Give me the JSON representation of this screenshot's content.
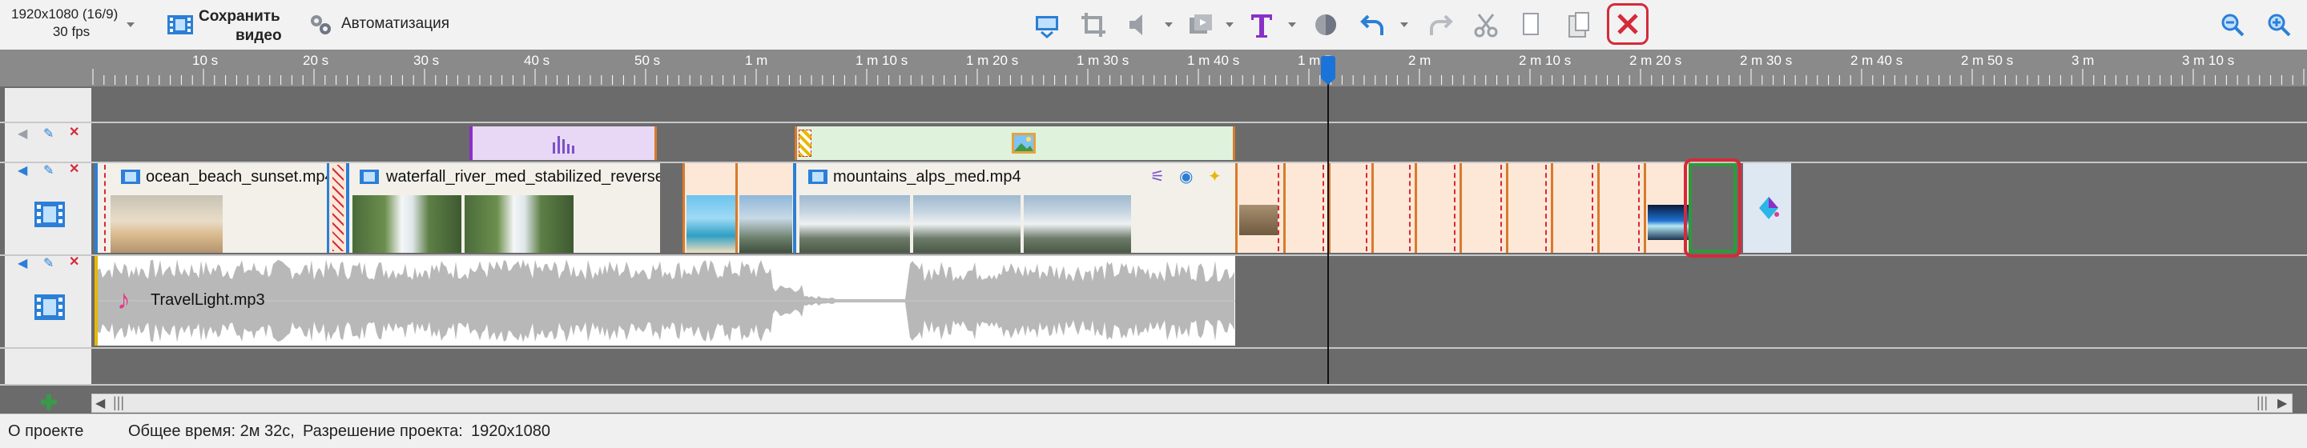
{
  "toolbar": {
    "resolution_line1": "1920x1080 (16/9)",
    "resolution_line2": "30 fps",
    "save_line1": "Сохранить",
    "save_line2": "видео",
    "automation_label": "Автоматизация",
    "icons": [
      "fit-timeline-icon",
      "crop-icon",
      "volume-icon",
      "transition-icon",
      "text-icon",
      "color-icon",
      "undo-icon",
      "redo-icon",
      "cut-icon",
      "copy-icon",
      "paste-icon",
      "delete-icon",
      "zoom-out-icon",
      "zoom-in-icon"
    ]
  },
  "ruler": {
    "labels": [
      "10 s",
      "20 s",
      "30 s",
      "40 s",
      "50 s",
      "1 m",
      "1 m 10 s",
      "1 m 20 s",
      "1 m 30 s",
      "1 m 40 s",
      "1 m 5",
      "2 m",
      "2 m 10 s",
      "2 m 20 s",
      "2 m 30 s",
      "2 m 40 s",
      "2 m 50 s",
      "3 m",
      "3 m 10 s"
    ]
  },
  "tracks": {
    "video_clips": [
      {
        "name": "ocean_beach_sunset.mp4"
      },
      {
        "name": "waterfall_river_med_stabilized_reverse..."
      },
      {
        "name": "mountains_alps_med.mp4"
      }
    ],
    "audio_clip": {
      "name": "TravelLight.mp3"
    }
  },
  "status": {
    "about": "О проекте",
    "total_time": "Общее время: 2м 32с,",
    "resolution_label": "Разрешение проекта:",
    "resolution_value": "1920x1080"
  },
  "colors": {
    "playhead": "#1a73d9",
    "highlight": "#d42a3a",
    "selected_clip": "#2e9a3a",
    "audio_bar": "#e6b800",
    "video_bar": "#2b7fd6"
  }
}
